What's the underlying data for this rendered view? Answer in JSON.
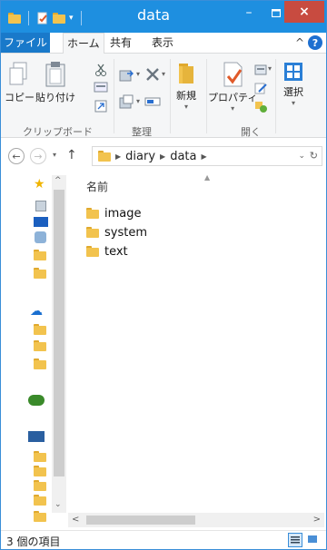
{
  "window": {
    "title": "data"
  },
  "ribbon_tabs": {
    "file": "ファイル",
    "home": "ホーム",
    "share": "共有",
    "view": "表示"
  },
  "ribbon": {
    "copy": "コピー",
    "paste": "貼り付け",
    "new": "新規",
    "properties": "プロパティ",
    "select": "選択",
    "groups": {
      "clipboard": "クリップボード",
      "organize": "整理",
      "open": "開く"
    }
  },
  "address": {
    "path": [
      "diary",
      "data"
    ]
  },
  "content": {
    "column_name": "名前",
    "items": [
      {
        "name": "image"
      },
      {
        "name": "system"
      },
      {
        "name": "text"
      }
    ]
  },
  "status": {
    "item_count": "3 個の項目"
  },
  "colors": {
    "titlebar": "#1e8fe0",
    "file_tab": "#1979ca",
    "close": "#c84b40",
    "folder": "#f2c34e"
  }
}
